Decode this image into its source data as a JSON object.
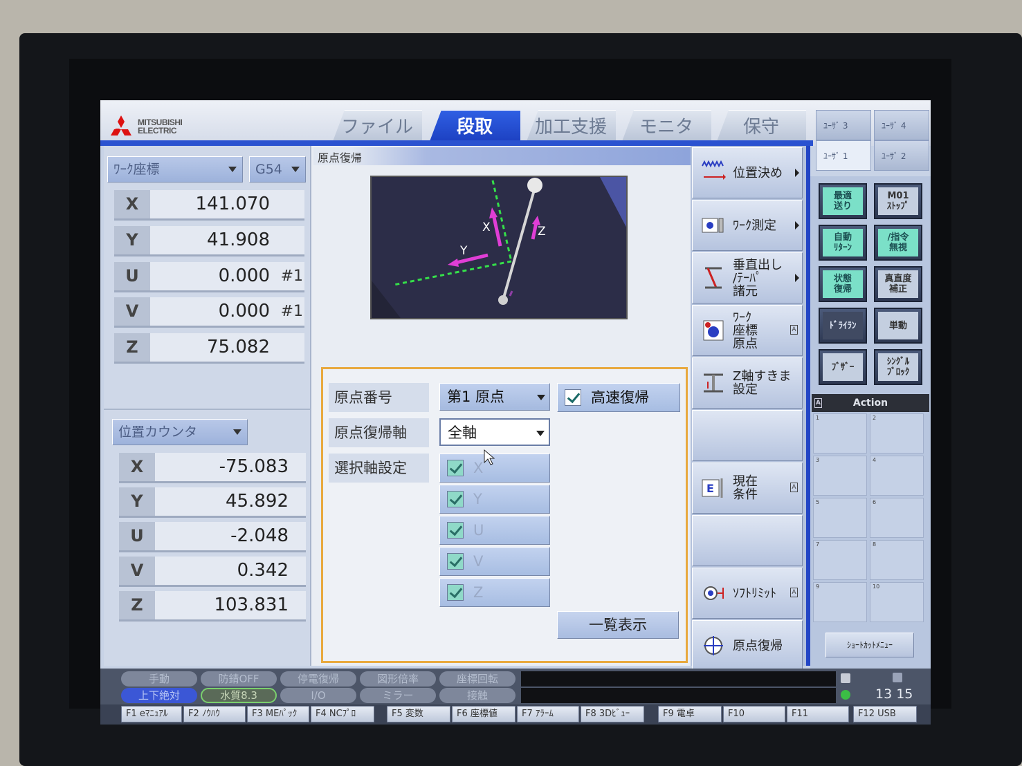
{
  "logo": {
    "line1": "MITSUBISHI",
    "line2": "ELECTRIC"
  },
  "tabs": [
    {
      "label": "ファイル"
    },
    {
      "label": "段取"
    },
    {
      "label": "加工支援"
    },
    {
      "label": "モニタ"
    },
    {
      "label": "保守"
    }
  ],
  "user_tabs": [
    "ﾕｰｻﾞ 3",
    "ﾕｰｻﾞ 4",
    "ﾕｰｻﾞ 1",
    "ﾕｰｻﾞ 2"
  ],
  "work_coord": {
    "dropdown": "ﾜｰｸ座標",
    "offset": "G54",
    "rows": [
      {
        "axis": "X",
        "value": "141.070",
        "suffix": ""
      },
      {
        "axis": "Y",
        "value": "41.908",
        "suffix": ""
      },
      {
        "axis": "U",
        "value": "0.000",
        "suffix": "#1"
      },
      {
        "axis": "V",
        "value": "0.000",
        "suffix": "#1"
      },
      {
        "axis": "Z",
        "value": "75.082",
        "suffix": ""
      }
    ]
  },
  "position_counter": {
    "dropdown": "位置カウンタ",
    "rows": [
      {
        "axis": "X",
        "value": "-75.083"
      },
      {
        "axis": "Y",
        "value": "45.892"
      },
      {
        "axis": "U",
        "value": "-2.048"
      },
      {
        "axis": "V",
        "value": "0.342"
      },
      {
        "axis": "Z",
        "value": "103.831"
      }
    ]
  },
  "origin_return": {
    "title": "原点復帰",
    "view_labels": {
      "x": "X",
      "y": "Y",
      "z": "Z"
    },
    "origin_number_label": "原点番号",
    "origin_number_value": "第1 原点",
    "fast_return_label": "高速復帰",
    "axis_label": "原点復帰軸",
    "axis_value": "全軸",
    "select_label": "選択軸設定",
    "axes": [
      "X",
      "Y",
      "U",
      "V",
      "Z"
    ],
    "list_button": "一覧表示"
  },
  "menu": [
    {
      "label": "位置決め"
    },
    {
      "label": "ﾜｰｸ測定"
    },
    {
      "label": "垂直出し\n/ﾃｰﾊﾟ\n諸元"
    },
    {
      "label": "ﾜｰｸ\n座標\n原点"
    },
    {
      "label": "Z軸すきま\n設定"
    },
    {
      "label": ""
    },
    {
      "label": "現在\n条件"
    },
    {
      "label": ""
    },
    {
      "label": "ｿﾌﾄﾘﾐｯﾄ"
    },
    {
      "label": "原点復帰"
    }
  ],
  "side_buttons": [
    {
      "label": "最適\n送り"
    },
    {
      "label": "M01\nｽﾄｯﾌﾟ"
    },
    {
      "label": "自動\nﾘﾀｰﾝ"
    },
    {
      "label": "/指令\n無視"
    },
    {
      "label": "状態\n復帰"
    },
    {
      "label": "真直度\n補正"
    },
    {
      "label": "ﾄﾞﾗｲﾗﾝ"
    },
    {
      "label": "単動"
    },
    {
      "label": "ﾌﾞｻﾞｰ"
    },
    {
      "label": "ｼﾝｸﾞﾙ\nﾌﾞﾛｯｸ"
    }
  ],
  "action": {
    "title": "Action",
    "slots": [
      "1",
      "2",
      "3",
      "4",
      "5",
      "6",
      "7",
      "8",
      "9",
      "10"
    ],
    "shortcut": "ｼｮｰﾄｶｯﾄﾒﾆｭｰ"
  },
  "status": {
    "row1": [
      "手動",
      "防錆OFF",
      "停電復帰",
      "図形倍率",
      "座標回転"
    ],
    "row2": [
      "上下絶対",
      "水質8.3",
      "I/O",
      "ミラー",
      "接触"
    ],
    "clock": "13 15"
  },
  "fkeys": [
    "F1 eﾏﾆｭｱﾙ",
    "F2 ﾉｳﾊｳ",
    "F3 MEﾊﾟｯｸ",
    "F4 NCﾌﾟﾛ",
    "F5 変数",
    "F6 座標値",
    "F7 ｱﾗｰﾑ",
    "F8 3Dﾋﾞｭｰ",
    "F9 電卓",
    "F10",
    "F11",
    "F12 USB"
  ],
  "colors": {
    "accent": "#2245c5",
    "highlight": "#e8a93e",
    "check": "#8fd9c8"
  }
}
